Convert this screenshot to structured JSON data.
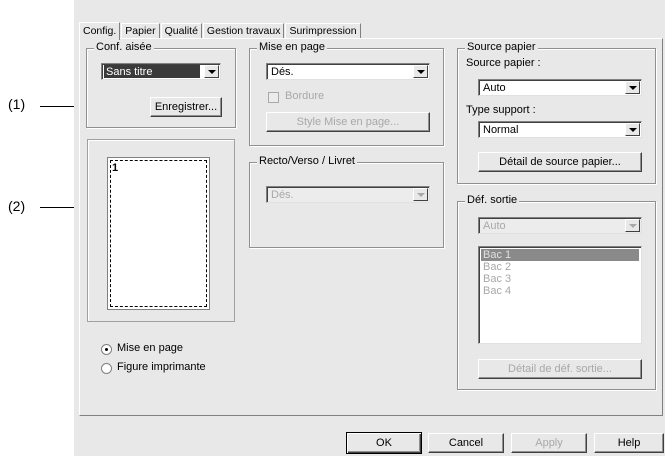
{
  "tabs": [
    "Config.",
    "Papier",
    "Qualité",
    "Gestion travaux",
    "Surimpression"
  ],
  "conf_aisee": {
    "title": "Conf. aisée",
    "select_value": "Sans titre",
    "save_button": "Enregistrer..."
  },
  "mise_en_page": {
    "title": "Mise en page",
    "select_value": "Dés.",
    "bordure_label": "Bordure",
    "style_button": "Style Mise en page..."
  },
  "recto_verso": {
    "title": "Recto/Verso / Livret",
    "select_value": "Dés."
  },
  "source_papier": {
    "title": "Source papier",
    "source_label": "Source papier :",
    "source_value": "Auto",
    "type_label": "Type support :",
    "type_value": "Normal",
    "detail_button": "Détail de source papier..."
  },
  "def_sortie": {
    "title": "Déf. sortie",
    "select_value": "Auto",
    "bins": [
      "Bac 1",
      "Bac 2",
      "Bac 3",
      "Bac 4"
    ],
    "selected_bin_index": 0,
    "detail_button": "Détail de déf. sortie..."
  },
  "preview": {
    "page_number": "1",
    "view_options": [
      "Mise en page",
      "Figure imprimante"
    ],
    "selected_view_index": 0
  },
  "footer": {
    "ok": "OK",
    "cancel": "Cancel",
    "apply": "Apply",
    "help": "Help"
  },
  "callouts": [
    "(1)",
    "(2)"
  ]
}
